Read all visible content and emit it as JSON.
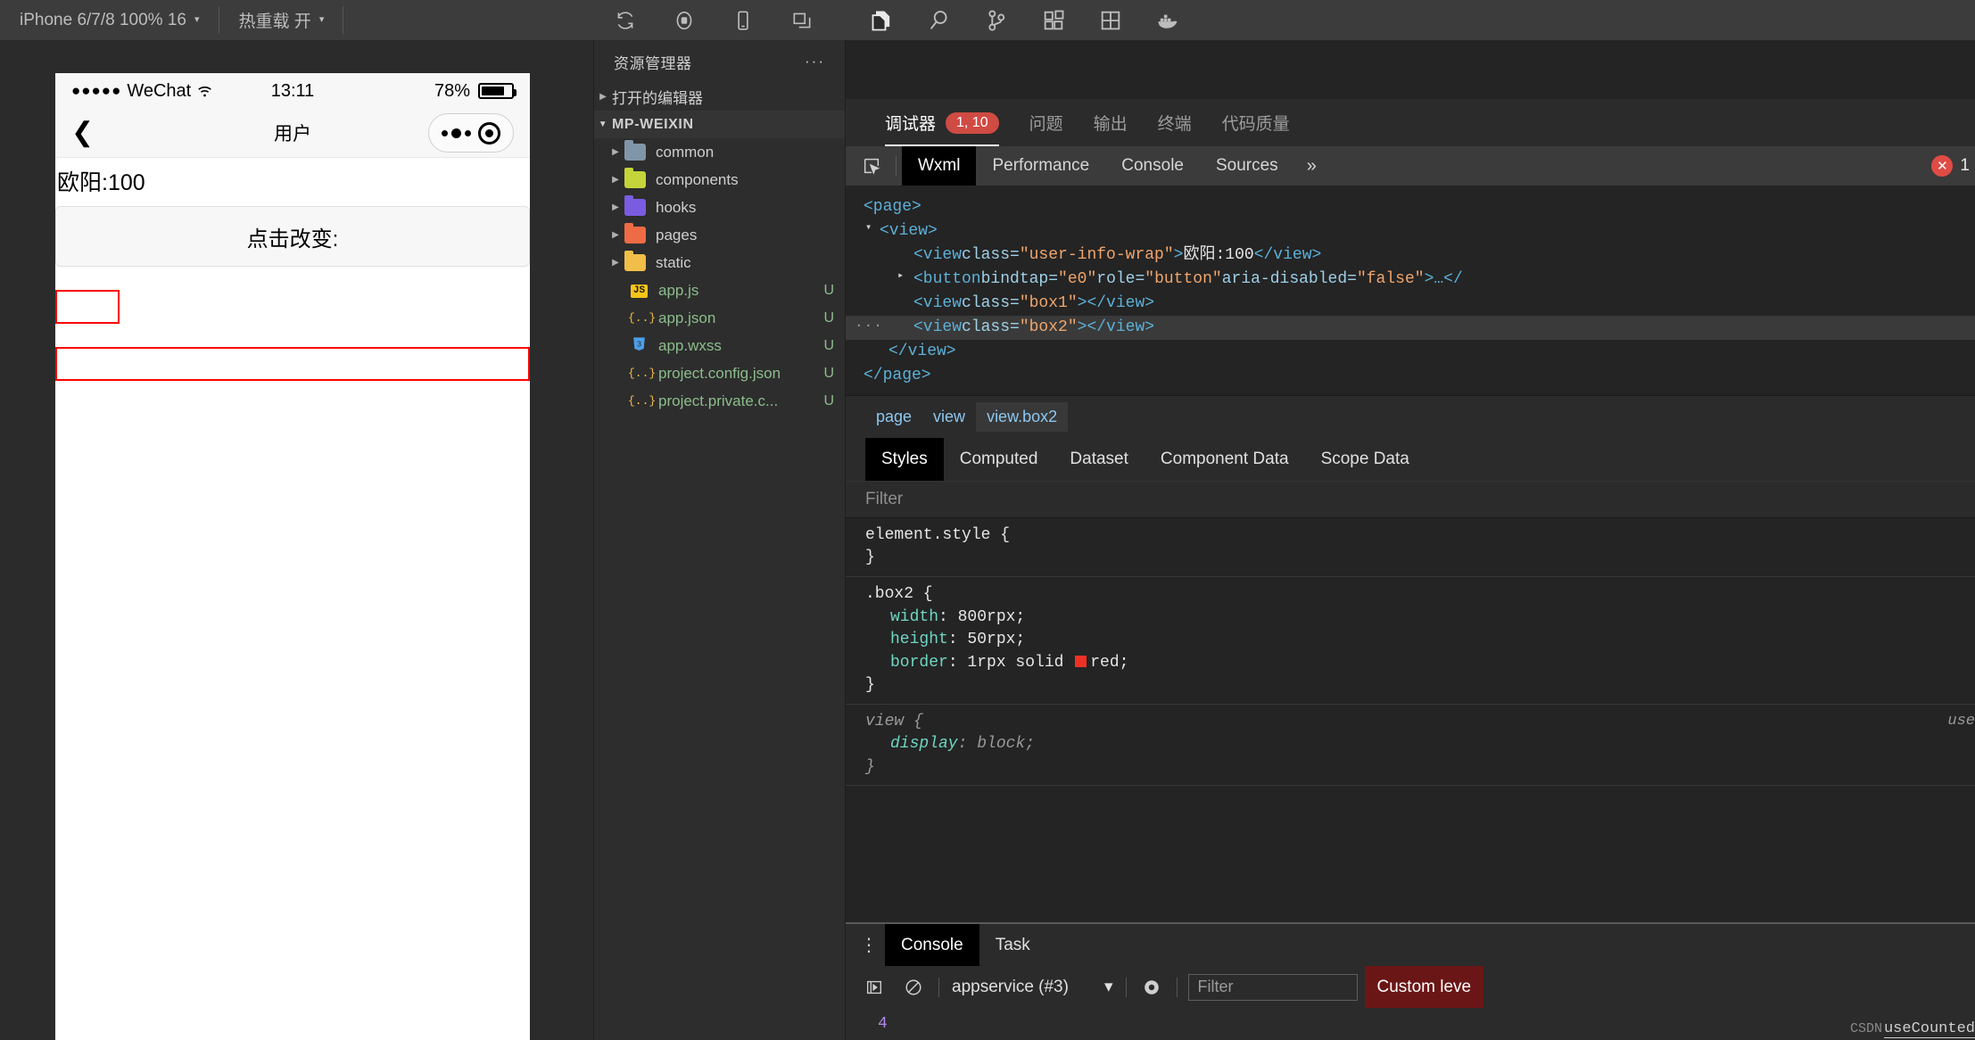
{
  "toolbar": {
    "device_label": "iPhone 6/7/8 100% 16",
    "hotreload_label": "热重载 开",
    "icons": [
      "refresh-icon",
      "record-stop-icon",
      "phone-icon",
      "windows-icon"
    ],
    "activity_icons": [
      "files-icon",
      "search-icon",
      "source-control-icon",
      "extensions-icon",
      "layout-icon",
      "docker-icon"
    ]
  },
  "simulator": {
    "status": {
      "carrier": "WeChat",
      "dots": "●●●●●",
      "time": "13:11",
      "battery": "78%"
    },
    "nav": {
      "back": "❮",
      "title": "用户"
    },
    "page": {
      "user_info": "欧阳:100",
      "button_label": "点击改变:",
      "box1_class": "box1",
      "box2_class": "box2"
    }
  },
  "explorer": {
    "title": "资源管理器",
    "more": "···",
    "open_editors": "打开的编辑器",
    "project": "MP-WEIXIN",
    "folders": [
      {
        "name": "common",
        "color": "#8096a8"
      },
      {
        "name": "components",
        "color": "#c5d43a"
      },
      {
        "name": "hooks",
        "color": "#7a5ce0"
      },
      {
        "name": "pages",
        "color": "#ef6b45"
      },
      {
        "name": "static",
        "color": "#f2be4a"
      }
    ],
    "files": [
      {
        "name": "app.js",
        "icon": "js",
        "git": "U"
      },
      {
        "name": "app.json",
        "icon": "json",
        "git": "U"
      },
      {
        "name": "app.wxss",
        "icon": "css",
        "git": "U"
      },
      {
        "name": "project.config.json",
        "icon": "json",
        "git": "U"
      },
      {
        "name": "project.private.c...",
        "icon": "json",
        "git": "U"
      }
    ]
  },
  "devtools": {
    "panel_tabs": [
      {
        "label": "调试器",
        "badge": "1, 10",
        "active": true
      },
      {
        "label": "问题",
        "badge": "",
        "active": false
      },
      {
        "label": "输出",
        "badge": "",
        "active": false
      },
      {
        "label": "终端",
        "badge": "",
        "active": false
      },
      {
        "label": "代码质量",
        "badge": "",
        "active": false
      }
    ],
    "dev_tabs": [
      {
        "label": "Wxml",
        "active": true
      },
      {
        "label": "Performance",
        "active": false
      },
      {
        "label": "Console",
        "active": false
      },
      {
        "label": "Sources",
        "active": false
      }
    ],
    "more_chevron": "»",
    "error_badge": {
      "icon": "✕",
      "count": "1"
    },
    "wxml": [
      {
        "indent": 0,
        "tri": "",
        "dots": false,
        "selected": false,
        "segments": [
          {
            "t": "tag",
            "v": "<page>"
          }
        ]
      },
      {
        "indent": 1,
        "tri": "▾",
        "dots": false,
        "selected": false,
        "segments": [
          {
            "t": "tag",
            "v": "<view>"
          }
        ]
      },
      {
        "indent": 3,
        "tri": "",
        "dots": false,
        "selected": false,
        "segments": [
          {
            "t": "tag",
            "v": "<view "
          },
          {
            "t": "attr",
            "v": "class="
          },
          {
            "t": "val",
            "v": "\"user-info-wrap\""
          },
          {
            "t": "tag",
            "v": ">"
          },
          {
            "t": "txt",
            "v": "欧阳:100"
          },
          {
            "t": "tag",
            "v": "</view>"
          }
        ]
      },
      {
        "indent": 2,
        "tri": "▸",
        "dots": false,
        "selected": false,
        "segments": [
          {
            "t": "tag",
            "v": "<button "
          },
          {
            "t": "attr",
            "v": "bindtap="
          },
          {
            "t": "val",
            "v": "\"e0\""
          },
          {
            "t": "attr",
            "v": " role="
          },
          {
            "t": "val",
            "v": "\"button\""
          },
          {
            "t": "attr",
            "v": " aria-disabled="
          },
          {
            "t": "val",
            "v": "\"false\""
          },
          {
            "t": "tag",
            "v": ">…</"
          }
        ]
      },
      {
        "indent": 3,
        "tri": "",
        "dots": false,
        "selected": false,
        "segments": [
          {
            "t": "tag",
            "v": "<view "
          },
          {
            "t": "attr",
            "v": "class="
          },
          {
            "t": "val",
            "v": "\"box1\""
          },
          {
            "t": "tag",
            "v": "></view>"
          }
        ]
      },
      {
        "indent": 3,
        "tri": "",
        "dots": true,
        "selected": true,
        "segments": [
          {
            "t": "tag",
            "v": "<view "
          },
          {
            "t": "attr",
            "v": "class="
          },
          {
            "t": "val",
            "v": "\"box2\""
          },
          {
            "t": "tag",
            "v": "></view>"
          }
        ]
      },
      {
        "indent": 2,
        "tri": "",
        "dots": false,
        "selected": false,
        "segments": [
          {
            "t": "tag",
            "v": "</view>"
          }
        ]
      },
      {
        "indent": 0,
        "tri": "",
        "dots": false,
        "selected": false,
        "segments": [
          {
            "t": "tag",
            "v": "</page>"
          }
        ]
      }
    ],
    "breadcrumbs": [
      {
        "label": "page",
        "active": false
      },
      {
        "label": "view",
        "active": false
      },
      {
        "label": "view.box2",
        "active": true
      }
    ],
    "style_tabs": [
      {
        "label": "Styles",
        "active": true
      },
      {
        "label": "Computed",
        "active": false
      },
      {
        "label": "Dataset",
        "active": false
      },
      {
        "label": "Component Data",
        "active": false
      },
      {
        "label": "Scope Data",
        "active": false
      }
    ],
    "filter_placeholder": "Filter",
    "css_rules": [
      {
        "selector": "element.style {",
        "close": "}",
        "greyed": false,
        "origin": "",
        "decls": []
      },
      {
        "selector": ".box2 {",
        "close": "}",
        "greyed": false,
        "origin": "",
        "decls": [
          {
            "prop": "width",
            "value": "800rpx;",
            "swatch": ""
          },
          {
            "prop": "height",
            "value": "50rpx;",
            "swatch": ""
          },
          {
            "prop": "border",
            "value": "1rpx solid red;",
            "swatch": "#ee3124"
          }
        ]
      },
      {
        "selector": "view {",
        "close": "}",
        "greyed": true,
        "origin": "use",
        "decls": [
          {
            "prop": "display",
            "value": "block;",
            "swatch": ""
          }
        ]
      }
    ]
  },
  "console": {
    "tabs": [
      {
        "label": "Console",
        "active": true
      },
      {
        "label": "Task",
        "active": false
      }
    ],
    "kebab": "⋮",
    "context": "appservice (#3)",
    "context_caret": "▾",
    "filter_placeholder": "Filter",
    "custom_level": "Custom leve",
    "log_line": "4",
    "watermark_csdn": "CSDN",
    "watermark_text": "useCounted"
  }
}
